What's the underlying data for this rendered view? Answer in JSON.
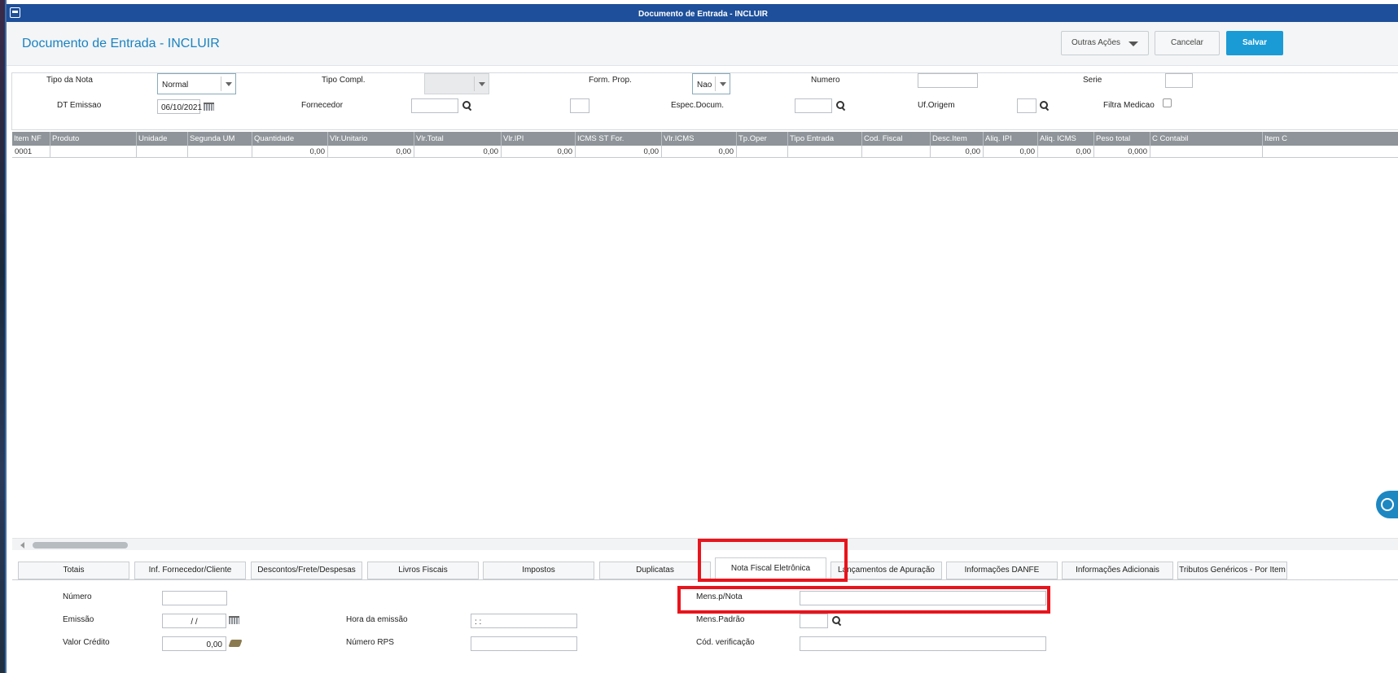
{
  "window": {
    "title": "Documento de Entrada - INCLUIR"
  },
  "header": {
    "page_title": "Documento de Entrada - INCLUIR",
    "other_actions_label": "Outras Ações",
    "cancel_label": "Cancelar",
    "save_label": "Salvar"
  },
  "form": {
    "tipo_nota_label": "Tipo da Nota",
    "tipo_nota_value": "Normal",
    "tipo_compl_label": "Tipo Compl.",
    "tipo_compl_value": "",
    "form_prop_label": "Form. Prop.",
    "form_prop_value": "Nao",
    "numero_label": "Numero",
    "numero_value": "",
    "serie_label": "Serie",
    "serie_value": "",
    "dt_emissao_label": "DT Emissao",
    "dt_emissao_value": "06/10/2021",
    "fornecedor_label": "Fornecedor",
    "fornecedor_value": "",
    "loja_value": "",
    "espec_docum_label": "Espec.Docum.",
    "espec_docum_value": "",
    "uf_origem_label": "Uf.Origem",
    "uf_origem_value": "",
    "filtra_medicao_label": "Filtra Medicao",
    "filtra_medicao_checked": false
  },
  "grid": {
    "columns": [
      "Item NF",
      "Produto",
      "Unidade",
      "Segunda UM",
      "Quantidade",
      "Vlr.Unitario",
      "Vlr.Total",
      "Vlr.IPI",
      "ICMS ST For.",
      "Vlr.ICMS",
      "Tp.Oper",
      "Tipo Entrada",
      "Cod. Fiscal",
      "Desc.Item",
      "Aliq. IPI",
      "Aliq. ICMS",
      "Peso total",
      "C Contabil",
      "Item C"
    ],
    "rows": [
      [
        "0001",
        "",
        "",
        "",
        "0,00",
        "0,00",
        "0,00",
        "0,00",
        "0,00",
        "0,00",
        "",
        "",
        "",
        "0,00",
        "0,00",
        "0,00",
        "0,000",
        "",
        ""
      ]
    ]
  },
  "tabs": [
    {
      "label": "Totais"
    },
    {
      "label": "Inf. Fornecedor/Cliente"
    },
    {
      "label": "Descontos/Frete/Despesas"
    },
    {
      "label": "Livros Fiscais"
    },
    {
      "label": "Impostos"
    },
    {
      "label": "Duplicatas"
    },
    {
      "label": "Nota Fiscal Eletrônica"
    },
    {
      "label": "Lançamentos de Apuração"
    },
    {
      "label": "Informações DANFE"
    },
    {
      "label": "Informações Adicionais"
    },
    {
      "label": "Tributos Genéricos - Por Item"
    }
  ],
  "active_tab": "Nota Fiscal Eletrônica",
  "nfe": {
    "numero_label": "Número",
    "numero_value": "",
    "emissao_label": "Emissão",
    "emissao_value": "/ /",
    "valor_credito_label": "Valor Crédito",
    "valor_credito_value": "0,00",
    "hora_emissao_label": "Hora da emissão",
    "hora_emissao_value": ": :",
    "numero_rps_label": "Número RPS",
    "numero_rps_value": "",
    "mens_nota_label": "Mens.p/Nota",
    "mens_nota_value": "",
    "mens_padrao_label": "Mens.Padrão",
    "mens_padrao_value": "",
    "cod_verificacao_label": "Cód. verificação",
    "cod_verificacao_value": ""
  },
  "colors": {
    "title_bar": "#1e4f9a",
    "accent": "#1b83c0",
    "save_button": "#1a9bd5",
    "grid_header": "#8e9499",
    "highlight": "#e8141c"
  }
}
